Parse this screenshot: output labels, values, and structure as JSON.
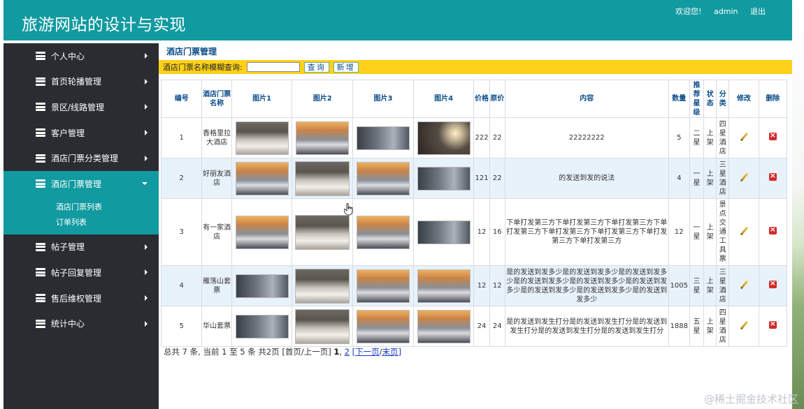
{
  "header": {
    "site_title": "旅游网站的设计与实现",
    "welcome": "欢迎您!",
    "user": "admin",
    "logout": "退出"
  },
  "sidebar": {
    "items": [
      {
        "label": "个人中心"
      },
      {
        "label": "首页轮播管理"
      },
      {
        "label": "景区/线路管理"
      },
      {
        "label": "客户管理"
      },
      {
        "label": "酒店门票分类管理"
      },
      {
        "label": "酒店门票管理",
        "active": true
      },
      {
        "label": "帖子管理"
      },
      {
        "label": "帖子回复管理"
      },
      {
        "label": "售后维权管理"
      },
      {
        "label": "统计中心"
      }
    ],
    "submenu": [
      "酒店门票列表",
      "订单列表"
    ]
  },
  "main": {
    "breadcrumb": "酒店门票管理",
    "search": {
      "label": "酒店门票名称模糊查询:",
      "value": "",
      "query_button": "查询",
      "add_button": "新增"
    },
    "table": {
      "headers": [
        "编号",
        "酒店门票名称",
        "图片1",
        "图片2",
        "图片3",
        "图片4",
        "价格",
        "原价",
        "内容",
        "数量",
        "推荐星级",
        "状态",
        "分类",
        "修改",
        "删除"
      ],
      "rows": [
        {
          "id": "1",
          "name": "香格里拉大酒店",
          "images": [
            "bed",
            "car",
            "box",
            "lamp"
          ],
          "price": "222",
          "original": "22",
          "content": "22222222",
          "qty": "5",
          "stars": "二星",
          "status": "上架",
          "category": "四星酒店"
        },
        {
          "id": "2",
          "name": "好丽友酒店",
          "images": [
            "car",
            "bed",
            "car",
            "box"
          ],
          "price": "121",
          "original": "22",
          "content": "的发送到发的说法",
          "qty": "4",
          "stars": "一星",
          "status": "上架",
          "category": "三星酒店"
        },
        {
          "id": "3",
          "name": "有一家酒店",
          "images": [
            "car",
            "bed",
            "car",
            "box"
          ],
          "price": "12",
          "original": "16",
          "content": "下单打发第三方下单打发第三方下单打发第三方下单打发第三方下单打发第三方下单打发第三方下单打发第三方下单打发第三方",
          "qty": "12",
          "stars": "一星",
          "status": "上架",
          "category": "景点交通工具票"
        },
        {
          "id": "4",
          "name": "雁荡山套票",
          "images": [
            "box",
            "bed",
            "car",
            "car"
          ],
          "price": "12",
          "original": "12",
          "content": "是的发送到发多少是的发送到发多少是的发送到发多少是的发送到发多少是的发送到发多少是的发送到发多少是的发送到发多少是的发送到发多少是的发送到发多少",
          "qty": "1005",
          "stars": "三星",
          "status": "上架",
          "category": "三星酒店"
        },
        {
          "id": "5",
          "name": "华山套票",
          "images": [
            "box",
            "bed",
            "car",
            "car"
          ],
          "price": "24",
          "original": "24",
          "content": "是的发送到发生打分是的发送到发生打分是的发送到发生打分是的发送到发生打分是的发送到发生打分",
          "qty": "1888",
          "stars": "五星",
          "status": "上架",
          "category": "四星酒店"
        }
      ]
    },
    "pager": {
      "summary": "总共 7 条, 当前 1 至 5 条 共2页",
      "first_prev": "[首页/上一页]",
      "page1": "1",
      "page2": "2",
      "next": "[下一页",
      "last": "末页]"
    }
  },
  "watermark": "@稀土掘金技术社区",
  "icons": {
    "menu": "menu-icon",
    "edit": "edit-pencil-icon",
    "delete": "delete-icon",
    "chevron": "chevron-right-icon"
  },
  "colors": {
    "accent": "#119aa0",
    "sidebar": "#2a2c32",
    "search_bar": "#ffd11a",
    "row_alt": "#e8f2fb",
    "header_text": "#0d4d8a"
  }
}
